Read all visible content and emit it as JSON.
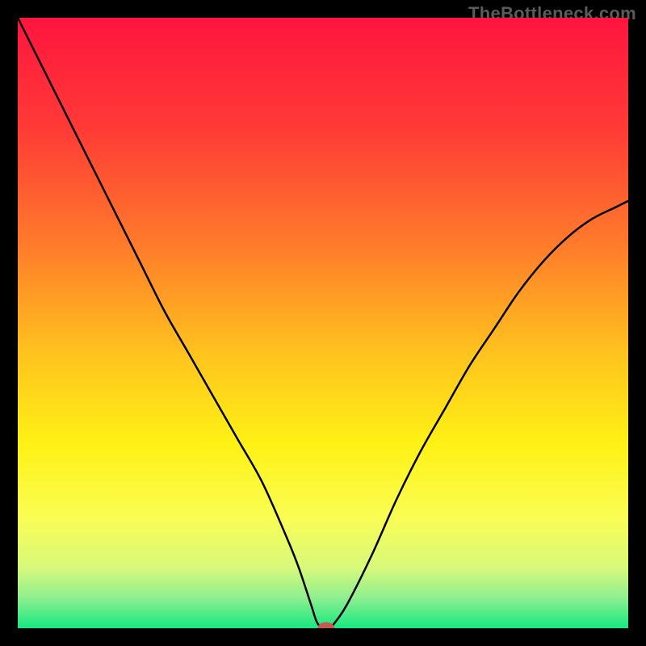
{
  "watermark": "TheBottleneck.com",
  "chart_data": {
    "type": "line",
    "title": "",
    "xlabel": "",
    "ylabel": "",
    "xlim": [
      0,
      100
    ],
    "ylim": [
      0,
      100
    ],
    "background_gradient": {
      "stops": [
        {
          "offset": 0.0,
          "color": "#ff153f"
        },
        {
          "offset": 0.18,
          "color": "#ff3a36"
        },
        {
          "offset": 0.38,
          "color": "#ff7e2a"
        },
        {
          "offset": 0.55,
          "color": "#ffc31e"
        },
        {
          "offset": 0.7,
          "color": "#fef215"
        },
        {
          "offset": 0.82,
          "color": "#fafd55"
        },
        {
          "offset": 0.9,
          "color": "#d8f97a"
        },
        {
          "offset": 0.95,
          "color": "#8fef91"
        },
        {
          "offset": 1.0,
          "color": "#17e880"
        }
      ]
    },
    "series": [
      {
        "name": "bottleneck-curve",
        "color": "#000000",
        "stroke_width": 2.5,
        "x": [
          0,
          4,
          8,
          12,
          16,
          20,
          24,
          28,
          32,
          36,
          40,
          44,
          46,
          48,
          49,
          50,
          51,
          52,
          54,
          58,
          62,
          66,
          70,
          74,
          78,
          82,
          86,
          90,
          94,
          98,
          100
        ],
        "y": [
          100,
          92,
          84,
          76,
          68,
          60,
          52,
          45,
          38,
          31,
          24,
          15,
          10,
          4,
          1,
          0,
          0,
          1,
          4,
          12,
          21,
          29,
          36,
          43,
          49,
          55,
          60,
          64,
          67,
          69,
          70
        ]
      }
    ],
    "marker": {
      "name": "optimal-point",
      "x": 50.5,
      "y": 0,
      "rx": 1.4,
      "ry": 1.0,
      "fill": "#c45a4f"
    }
  }
}
